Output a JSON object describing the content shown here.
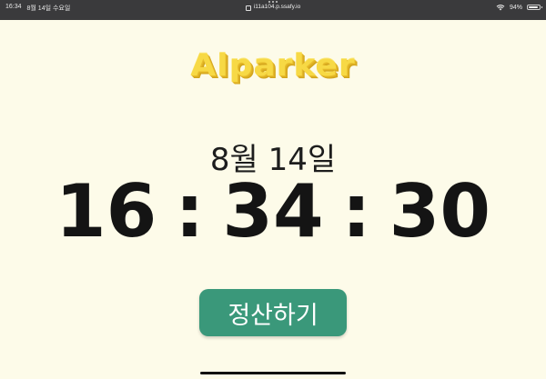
{
  "status_bar": {
    "time": "16:34",
    "date": "8월 14일 수요일",
    "url": "i11a104.p.ssafy.io",
    "battery_text": "94%",
    "battery_level": 0.94,
    "wifi_icon": "wifi-icon"
  },
  "app": {
    "logo_text": "Alparker"
  },
  "main": {
    "date": "8월 14일",
    "clock": {
      "hours": "16",
      "minutes": "34",
      "seconds": "30",
      "separator": ":"
    },
    "settle_button_label": "정산하기"
  },
  "colors": {
    "background": "#fdfbe9",
    "logo_yellow": "#f7d945",
    "button_green": "#3a987a",
    "status_bar": "#3a3a3c"
  }
}
